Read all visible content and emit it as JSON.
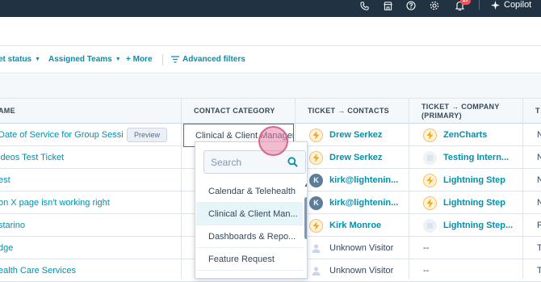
{
  "topbar": {
    "icons": [
      "phone-icon",
      "marketplace-icon",
      "help-icon",
      "settings-icon",
      "bell-icon"
    ],
    "notification_count": "17",
    "copilot_label": "Copilot"
  },
  "filters": {
    "items": [
      {
        "label": "et status",
        "caret": true
      },
      {
        "label": "Assigned Teams",
        "caret": true
      },
      {
        "label": "+ More",
        "caret": false
      },
      {
        "label": "Advanced filters",
        "caret": false
      }
    ]
  },
  "table": {
    "columns": [
      "AME",
      "CONTACT CATEGORY",
      "TICKET → CONTACTS",
      "TICKET → COMPANY (PRIMARY)",
      "T"
    ],
    "preview_label": "Preview",
    "rows": [
      {
        "name": "Date of Service for Group Sessi...",
        "contact": "Drew Serkez",
        "contact_avatar": "bolt",
        "company": "ZenCharts",
        "company_avatar": "bolt",
        "last": "N"
      },
      {
        "name": "ideos Test Ticket",
        "contact": "Drew Serkez",
        "contact_avatar": "bolt",
        "company": "Testing Intern...",
        "company_avatar": "ghost",
        "last": "N"
      },
      {
        "name": "est",
        "contact": "kirk@lightenin...",
        "contact_avatar": "k",
        "company": "Lightning Step",
        "company_avatar": "bolt",
        "last": "N"
      },
      {
        "name": "on X page isn't working right",
        "contact": "kirk@lightenin...",
        "contact_avatar": "k",
        "company": "Lightning Step",
        "company_avatar": "bolt",
        "last": "N"
      },
      {
        "name": "starino",
        "contact": "Kirk Monroe",
        "contact_avatar": "bolt",
        "company": "Lightning Step...",
        "company_avatar": "ghost",
        "last": "P"
      },
      {
        "name": "dge",
        "contact": "Unknown Visitor",
        "contact_avatar": "person",
        "company": "--",
        "company_avatar": "none",
        "last": "T"
      },
      {
        "name": "ealth Care Services",
        "contact": "Unknown Visitor",
        "contact_avatar": "person",
        "company": "--",
        "company_avatar": "none",
        "last": "T"
      }
    ]
  },
  "editor": {
    "value": "Clinical & Client Managem",
    "search_placeholder": "Search",
    "options": [
      {
        "label": "Calendar & Telehealth",
        "selected": false
      },
      {
        "label": "Clinical & Client Man...",
        "selected": true
      },
      {
        "label": "Dashboards & Repo...",
        "selected": false
      },
      {
        "label": "Feature Request",
        "selected": false
      },
      {
        "label": "",
        "selected": false
      }
    ]
  }
}
